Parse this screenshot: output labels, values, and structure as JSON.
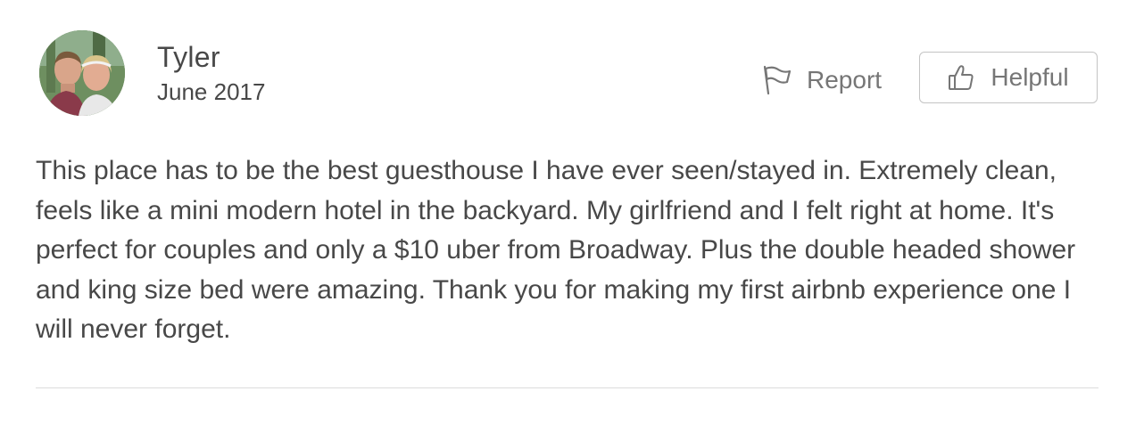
{
  "review": {
    "author_name": "Tyler",
    "date": "June 2017",
    "report_label": "Report",
    "helpful_label": "Helpful",
    "text": "This place has to be the best guesthouse I have ever seen/stayed in. Extremely clean, feels like a mini modern hotel in the backyard. My girlfriend and I felt right at home. It's perfect for couples and only a $10 uber from Broadway. Plus the double headed shower and king size bed were amazing. Thank you for making my first airbnb experience one I will never forget."
  },
  "icons": {
    "report": "flag-icon",
    "helpful": "thumbs-up-icon"
  },
  "colors": {
    "text": "#484848",
    "muted": "#767676",
    "border": "#c4c4c4",
    "divider": "#dcdcdc"
  }
}
